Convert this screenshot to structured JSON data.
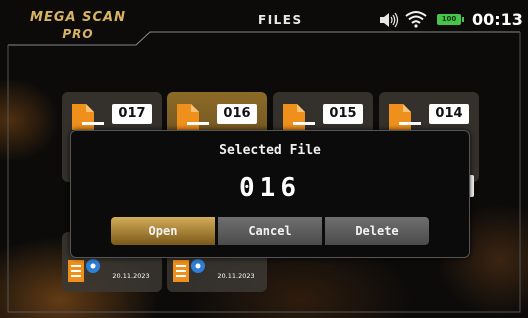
{
  "header": {
    "logo_line1": "MEGA SCAN",
    "logo_line2": "PRO",
    "title": "FILES",
    "battery": "100",
    "clock": "00:13"
  },
  "files": [
    {
      "number": "017",
      "selected": false
    },
    {
      "number": "016",
      "selected": true
    },
    {
      "number": "015",
      "selected": false
    },
    {
      "number": "014",
      "selected": false
    }
  ],
  "logs": [
    {
      "date": "20.11.2023"
    },
    {
      "date": "20.11.2023"
    }
  ],
  "dialog": {
    "title": "Selected File",
    "value": "016",
    "buttons": {
      "open": "Open",
      "cancel": "Cancel",
      "delete": "Delete"
    }
  },
  "colors": {
    "accent_gold": "#c9a24e",
    "battery_green": "#49c44a",
    "icon_orange": "#f0901c"
  }
}
